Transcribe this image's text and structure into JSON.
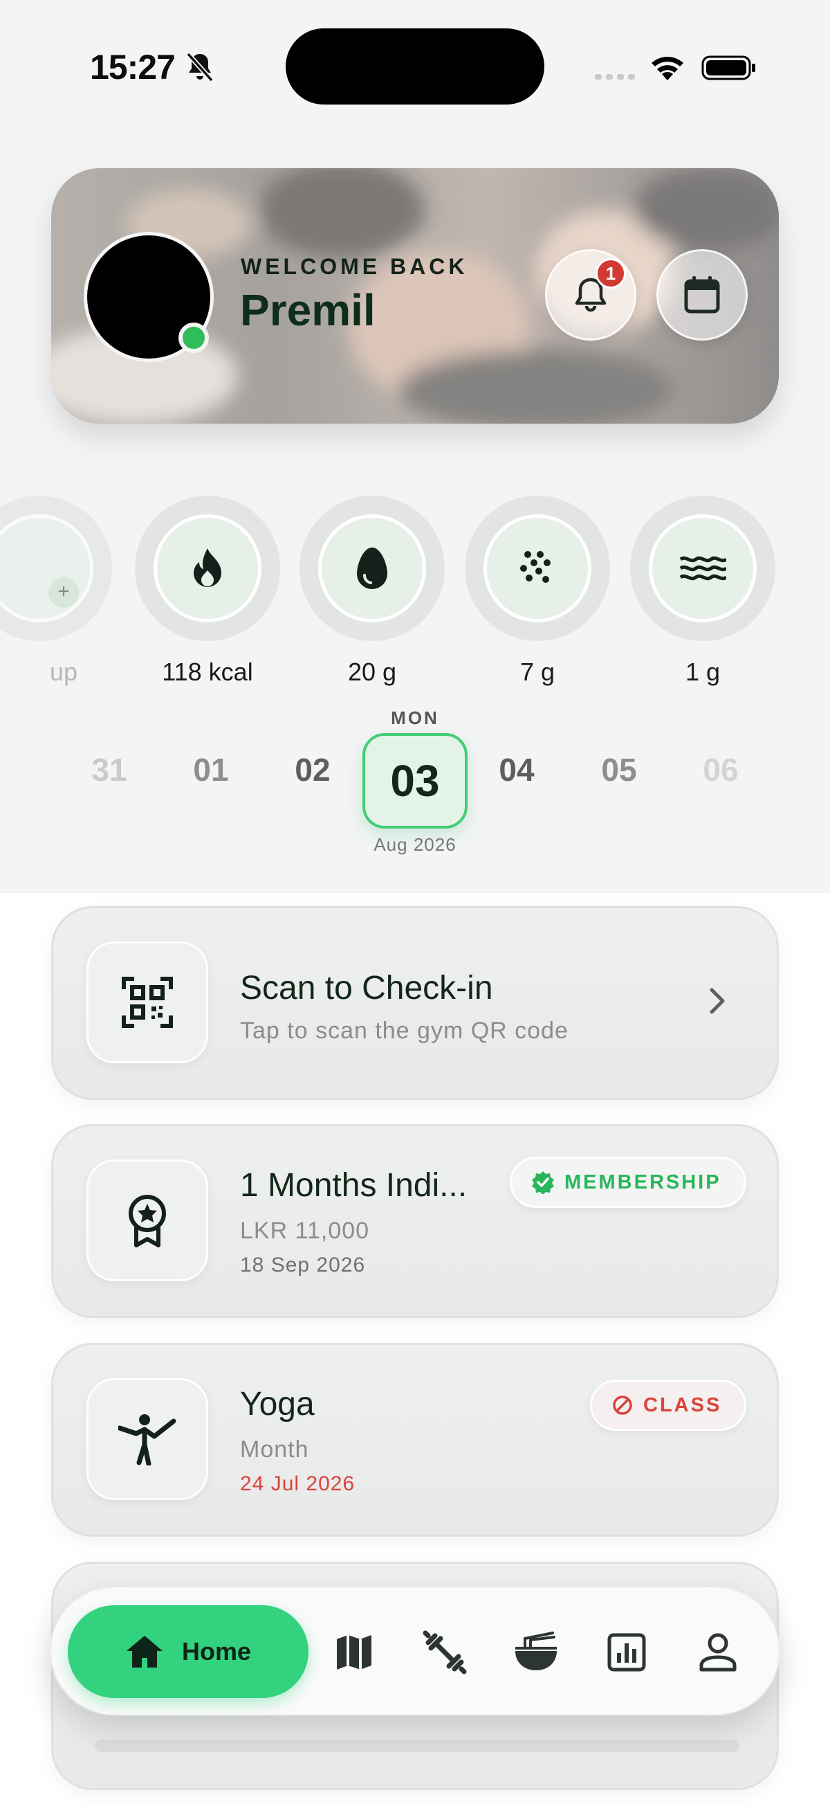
{
  "status_bar": {
    "time": "15:27",
    "silent_icon": "bell-slash-icon",
    "signal_icon": "signal-dots-icon",
    "wifi_icon": "wifi-icon",
    "battery_icon": "battery-icon"
  },
  "header": {
    "welcome_text": "WELCOME BACK",
    "user_name": "Premil",
    "online_status_color": "#2fbd57",
    "notification_icon": "bell-icon",
    "notification_count": "1",
    "calendar_icon": "calendar-icon"
  },
  "stats": [
    {
      "label": "up",
      "icon": "add-photo-icon"
    },
    {
      "label": "118 kcal",
      "icon": "flame-icon"
    },
    {
      "label": "20 g",
      "icon": "egg-protein-icon"
    },
    {
      "label": "7 g",
      "icon": "grain-carbs-icon"
    },
    {
      "label": "1 g",
      "icon": "waves-fat-icon"
    }
  ],
  "date_strip": {
    "day_of_week": "MON",
    "dates": [
      "31",
      "01",
      "02",
      "03",
      "04",
      "05",
      "06"
    ],
    "selected": "03",
    "month_year": "Aug 2026"
  },
  "cards": {
    "checkin": {
      "title": "Scan to Check-in",
      "subtitle": "Tap to scan the gym QR code",
      "icon": "qr-code-scan-icon"
    },
    "membership": {
      "title": "1 Months Indi...",
      "price": "LKR 11,000",
      "date": "18 Sep 2026",
      "badge": "MEMBERSHIP",
      "icon": "award-medal-icon",
      "badge_color": "#28b65a"
    },
    "class": {
      "title": "Yoga",
      "period": "Month",
      "date": "24 Jul 2026",
      "badge": "CLASS",
      "icon": "yoga-pose-icon",
      "badge_color": "#d9443b"
    }
  },
  "nav": {
    "home_label": "Home",
    "items": [
      "home-icon",
      "map-icon",
      "dumbbell-icon",
      "food-bowl-icon",
      "analytics-icon",
      "profile-icon"
    ],
    "accent": "#33d27e"
  }
}
